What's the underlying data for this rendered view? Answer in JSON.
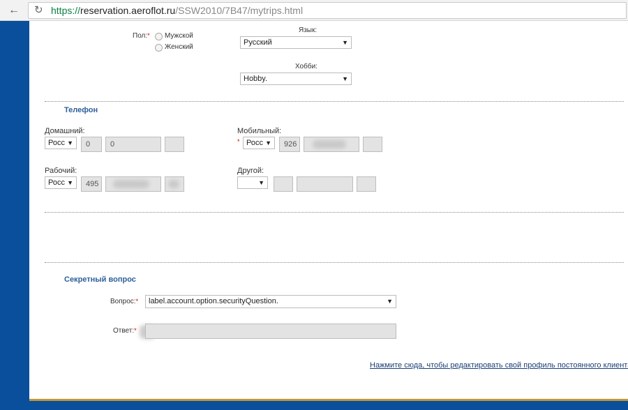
{
  "browser": {
    "back_icon": "arrow-left-icon",
    "reload_icon": "reload-icon",
    "url_scheme": "https://",
    "url_host": "reservation.aeroflot.ru",
    "url_path": "/SSW2010/7B47/mytrips.html"
  },
  "profile": {
    "gender_label": "Пол:",
    "gender_male": "Мужской",
    "gender_female": "Женский",
    "language_label": "Язык:",
    "language_value": "Русский",
    "hobby_label": "Хобби:",
    "hobby_value": "Hobby."
  },
  "phone": {
    "title": "Телефон",
    "home_label": "Домашний:",
    "home_country": "Росс",
    "home_field1": "0",
    "home_field2": "0",
    "mobile_label": "Мобильный:",
    "mobile_country": "Росс",
    "mobile_code": "926",
    "work_label": "Рабочий:",
    "work_country": "Росс",
    "work_code": "495",
    "other_label": "Другой:"
  },
  "security": {
    "title": "Секретный вопрос",
    "question_label": "Вопрос:",
    "question_value": "label.account.option.securityQuestion.",
    "answer_label": "Ответ:"
  },
  "footer": {
    "edit_profile_link": "Нажмите сюда, чтобы редактировать свой профиль постоянного клиента"
  },
  "colors": {
    "side_band": "#0a4f9c",
    "section_title": "#2d5f99",
    "required": "#cc0000"
  }
}
